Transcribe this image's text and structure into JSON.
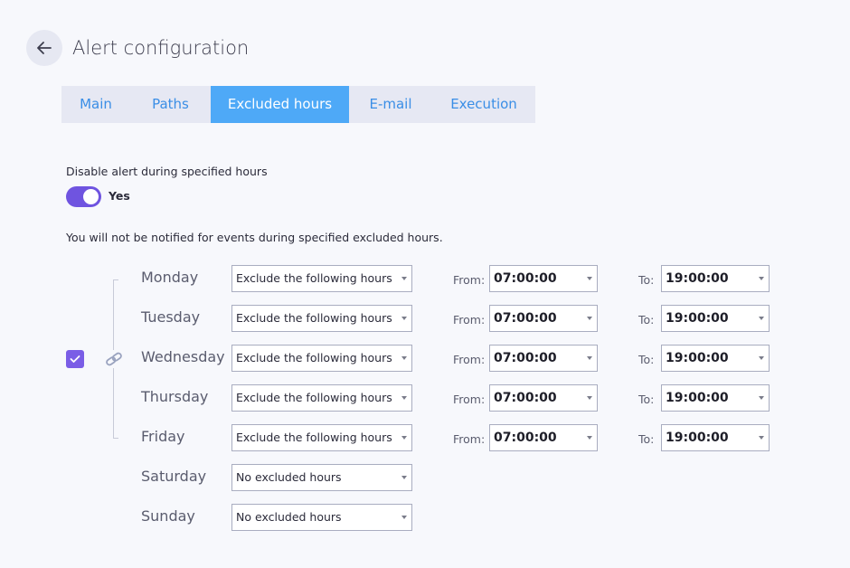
{
  "header": {
    "title": "Alert configuration",
    "back_icon": "arrow-left-icon"
  },
  "tabs": [
    {
      "label": "Main",
      "active": false
    },
    {
      "label": "Paths",
      "active": false
    },
    {
      "label": "Excluded hours",
      "active": true
    },
    {
      "label": "E-mail",
      "active": false
    },
    {
      "label": "Execution",
      "active": false
    }
  ],
  "excluded": {
    "disable_label": "Disable alert during specified hours",
    "toggle_on": true,
    "toggle_label": "Yes",
    "info": "You will not be notified for events during specified excluded hours.",
    "link_weekdays_checked": true,
    "from_label": "From:",
    "to_label": "To:",
    "days": [
      {
        "day": "Monday",
        "mode": "Exclude the following hours",
        "from": "07:00:00",
        "to": "19:00:00"
      },
      {
        "day": "Tuesday",
        "mode": "Exclude the following hours",
        "from": "07:00:00",
        "to": "19:00:00"
      },
      {
        "day": "Wednesday",
        "mode": "Exclude the following hours",
        "from": "07:00:00",
        "to": "19:00:00"
      },
      {
        "day": "Thursday",
        "mode": "Exclude the following hours",
        "from": "07:00:00",
        "to": "19:00:00"
      },
      {
        "day": "Friday",
        "mode": "Exclude the following hours",
        "from": "07:00:00",
        "to": "19:00:00"
      },
      {
        "day": "Saturday",
        "mode": "No excluded hours"
      },
      {
        "day": "Sunday",
        "mode": "No excluded hours"
      }
    ]
  },
  "colors": {
    "accent": "#6f54e0",
    "tab_active": "#4ea9f7",
    "tab_text": "#3a8ee6",
    "background": "#f7f8fc"
  }
}
